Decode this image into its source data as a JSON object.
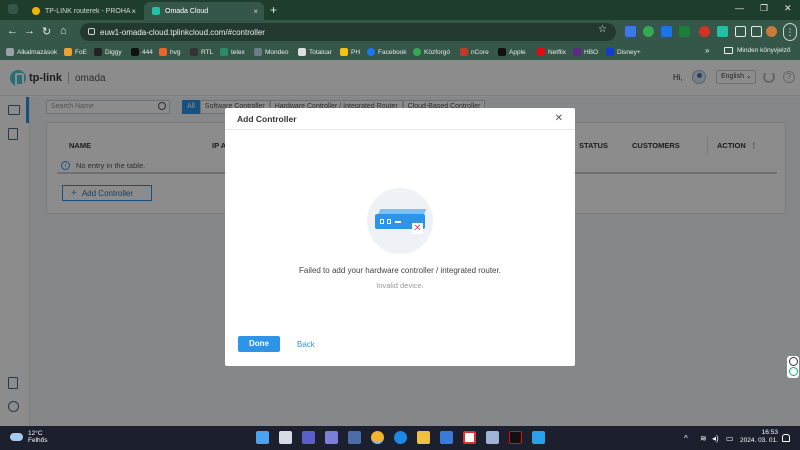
{
  "browser": {
    "tabs": [
      {
        "title": "TP-LINK routerek - PROHARDV",
        "active": false
      },
      {
        "title": "Omada Cloud",
        "active": true
      }
    ],
    "url": "euw1-omada-cloud.tplinkcloud.com/#controller",
    "bookmarks": [
      "Alkalmazások",
      "FoE",
      "Diggy",
      "444",
      "hvg",
      "RTL",
      "telex",
      "Mondeo",
      "Totalcar",
      "PH",
      "Facebook",
      "Közforgó",
      "nCore",
      "Apple",
      "Netflix",
      "HBO",
      "Disney+"
    ],
    "all_bookmarks_label": "Minden könyvjelző"
  },
  "app": {
    "brand": "tp-link",
    "product": "omada",
    "greeting": "Hi,",
    "language": "English"
  },
  "toolbar": {
    "search_placeholder": "Search Name",
    "filters": [
      "All",
      "Software Controller",
      "Hardware Controller / Integrated Router",
      "Cloud-Based Controller"
    ]
  },
  "table": {
    "columns": [
      "NAME",
      "IP A",
      "STATUS",
      "CUSTOMERS",
      "ACTION"
    ],
    "empty_text": "No entry in the table."
  },
  "add_controller_label": "Add Controller",
  "modal": {
    "title": "Add Controller",
    "message": "Failed to add your hardware controller / integrated router.",
    "submessage": "Invalid device.",
    "done_label": "Done",
    "back_label": "Back"
  },
  "taskbar": {
    "temperature": "12°C",
    "condition": "Felhős",
    "time": "16:53",
    "date": "2024. 03. 01."
  },
  "colors": {
    "accent": "#2d94e8",
    "error": "#e84a5f",
    "browser_frame": "#35574a"
  }
}
